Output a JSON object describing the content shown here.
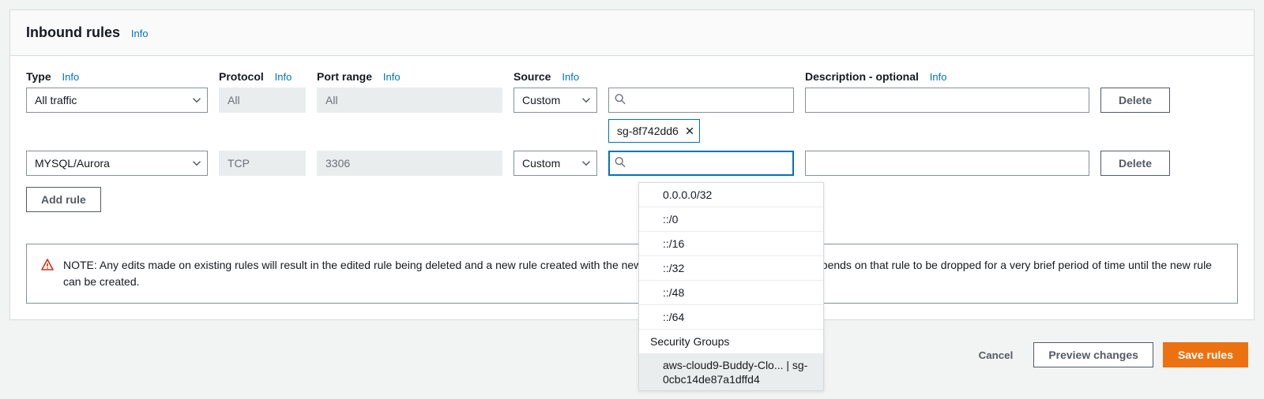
{
  "header": {
    "title": "Inbound rules",
    "info": "Info"
  },
  "columns": {
    "type": "Type",
    "protocol": "Protocol",
    "port": "Port range",
    "source": "Source",
    "description": "Description - optional",
    "info": "Info"
  },
  "rules": [
    {
      "type": "All traffic",
      "protocol": "All",
      "port": "All",
      "source_mode": "Custom",
      "source_tag": "sg-8f742dd6",
      "description": ""
    },
    {
      "type": "MYSQL/Aurora",
      "protocol": "TCP",
      "port": "3306",
      "source_mode": "Custom",
      "description": ""
    }
  ],
  "buttons": {
    "delete": "Delete",
    "add_rule": "Add rule",
    "cancel": "Cancel",
    "preview": "Preview changes",
    "save": "Save rules"
  },
  "note": "NOTE: Any edits made on existing rules will result in the edited rule being deleted and a new rule created with the new details. This will cause traffic that depends on that rule to be dropped for a very brief period of time until the new rule can be created.",
  "note_visible_prefix": "NOTE: Any edits made on existing rules will result in the edited rule being deleted and a new rule created with t",
  "note_visible_suffix": "that depends on that rule to be dropped for a very brief period of time until the new rule can be created.",
  "dropdown": {
    "items": [
      "0.0.0.0/32",
      "::/0",
      "::/16",
      "::/32",
      "::/48",
      "::/64"
    ],
    "group_label": "Security Groups",
    "sg_item": "aws-cloud9-Buddy-Clo... | sg-0cbc14de87a1dffd4"
  }
}
